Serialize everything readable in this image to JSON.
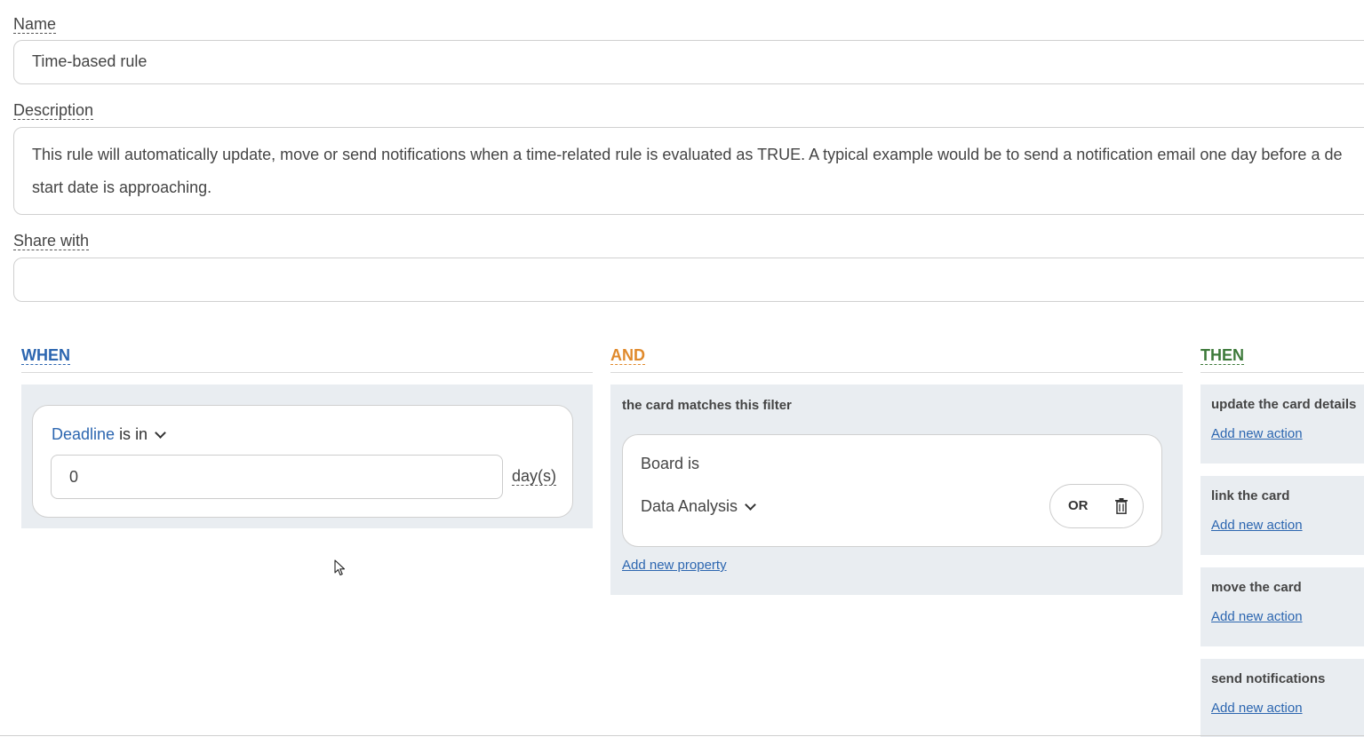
{
  "form": {
    "name_label": "Name",
    "name_value": "Time-based rule",
    "description_label": "Description",
    "description_line1": "This rule will automatically update, move or send notifications when a time-related rule is evaluated as TRUE. A typical example would be to send a notification email one day before a de",
    "description_line2": "start date is approaching.",
    "share_label": "Share with",
    "share_value": ""
  },
  "when": {
    "title": "WHEN",
    "title_color": "#2c66b0",
    "field": "Deadline",
    "operator": "is in",
    "days_value": "0",
    "days_unit": "day(s)"
  },
  "and": {
    "title": "AND",
    "title_color": "#e08a2c",
    "caption": "the card matches this filter",
    "filter_property": "Board is",
    "filter_value": "Data Analysis",
    "or_label": "OR",
    "add_property": "Add new property"
  },
  "then": {
    "title": "THEN",
    "title_color": "#3d7a3a",
    "groups": [
      {
        "title": "update the card details",
        "link": "Add new action"
      },
      {
        "title": "link the card",
        "link": "Add new action"
      },
      {
        "title": "move the card",
        "link": "Add new action"
      },
      {
        "title": "send notifications",
        "link": "Add new action"
      }
    ]
  }
}
